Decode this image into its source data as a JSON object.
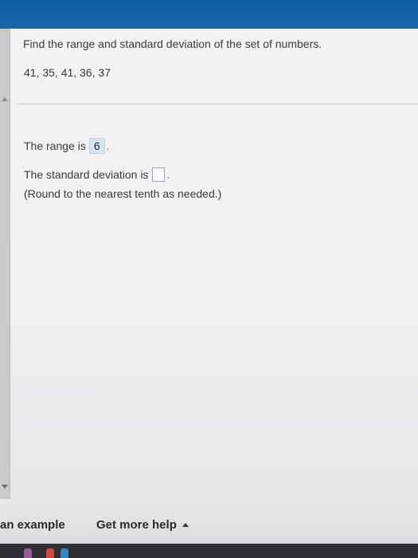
{
  "question": {
    "prompt": "Find the range and standard deviation of the set of numbers.",
    "numbers": "41, 35, 41, 36, 37"
  },
  "answers": {
    "range_label": "The range is",
    "range_value": "6",
    "range_suffix": ".",
    "sd_label": "The standard deviation is",
    "sd_value": "",
    "sd_suffix": ".",
    "hint": "(Round to the nearest tenth as needed.)"
  },
  "footer": {
    "example_label": "an example",
    "help_label": "Get more help"
  },
  "colors": {
    "top_bar": "#1766aa",
    "answer_highlight": "#d6e3f0",
    "input_border": "#8ea8c8"
  }
}
